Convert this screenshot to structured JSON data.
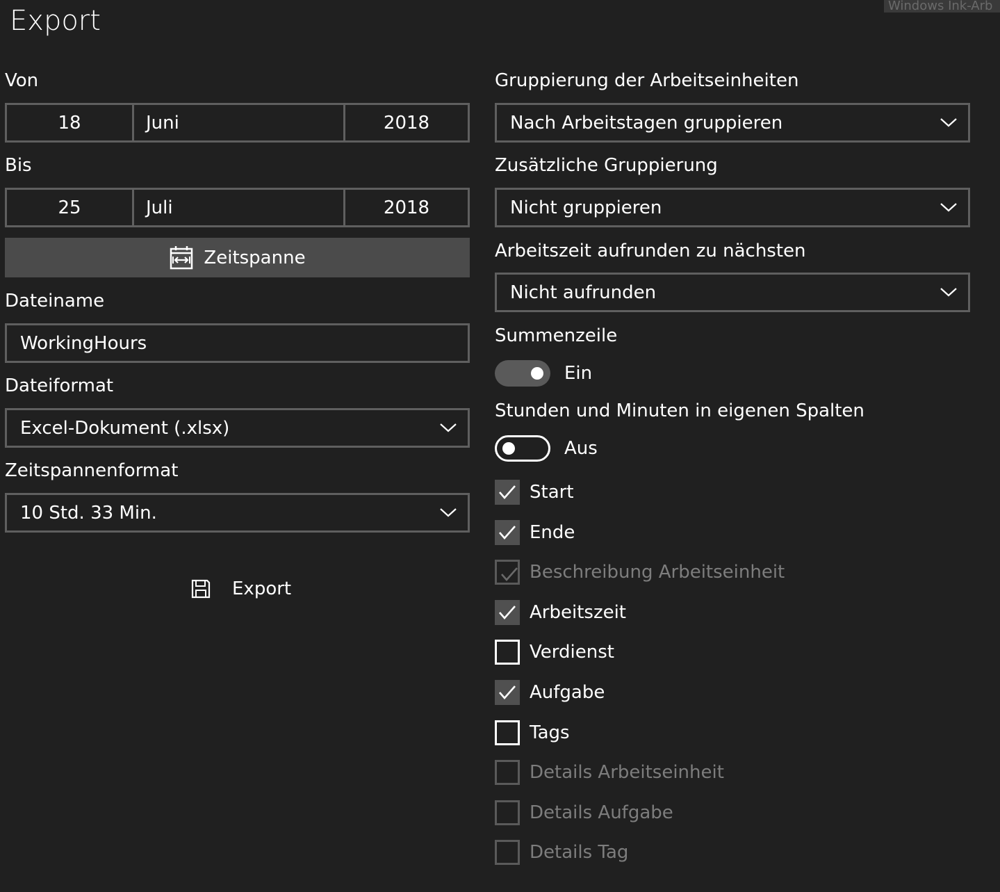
{
  "page": {
    "title": "Export",
    "watermark": "Windows Ink-Arb"
  },
  "left": {
    "from": {
      "label": "Von",
      "day": "18",
      "month": "Juni",
      "year": "2018"
    },
    "to": {
      "label": "Bis",
      "day": "25",
      "month": "Juli",
      "year": "2018"
    },
    "timespan_button": {
      "label": "Zeitspanne",
      "icon": "calendar-range-icon"
    },
    "filename": {
      "label": "Dateiname",
      "value": "WorkingHours"
    },
    "fileformat": {
      "label": "Dateiformat",
      "value": "Excel-Dokument (.xlsx)"
    },
    "timespanformat": {
      "label": "Zeitspannenformat",
      "value": "10 Std. 33 Min."
    },
    "export_button": {
      "label": "Export",
      "icon": "save-icon"
    }
  },
  "right": {
    "grouping": {
      "label": "Gruppierung der Arbeitseinheiten",
      "value": "Nach Arbeitstagen gruppieren"
    },
    "extra_grouping": {
      "label": "Zusätzliche Gruppierung",
      "value": "Nicht gruppieren"
    },
    "rounding": {
      "label": "Arbeitszeit aufrunden zu nächsten",
      "value": "Nicht aufrunden"
    },
    "sum_row": {
      "label": "Summenzeile",
      "state": "Ein",
      "on": true
    },
    "separate_columns": {
      "label": "Stunden und Minuten in eigenen Spalten",
      "state": "Aus",
      "on": false
    },
    "columns": [
      {
        "label": "Start",
        "checked": true,
        "enabled": true
      },
      {
        "label": "Ende",
        "checked": true,
        "enabled": true
      },
      {
        "label": "Beschreibung Arbeitseinheit",
        "checked": true,
        "enabled": false
      },
      {
        "label": "Arbeitszeit",
        "checked": true,
        "enabled": true
      },
      {
        "label": "Verdienst",
        "checked": false,
        "enabled": true
      },
      {
        "label": "Aufgabe",
        "checked": true,
        "enabled": true
      },
      {
        "label": "Tags",
        "checked": false,
        "enabled": true
      },
      {
        "label": "Details Arbeitseinheit",
        "checked": false,
        "enabled": false
      },
      {
        "label": "Details Aufgabe",
        "checked": false,
        "enabled": false
      },
      {
        "label": "Details Tag",
        "checked": false,
        "enabled": false
      }
    ]
  },
  "colors": {
    "background": "#202020",
    "border": "#5f5f5f",
    "button": "#4b4b4b",
    "disabled_text": "#7d7d7d"
  }
}
